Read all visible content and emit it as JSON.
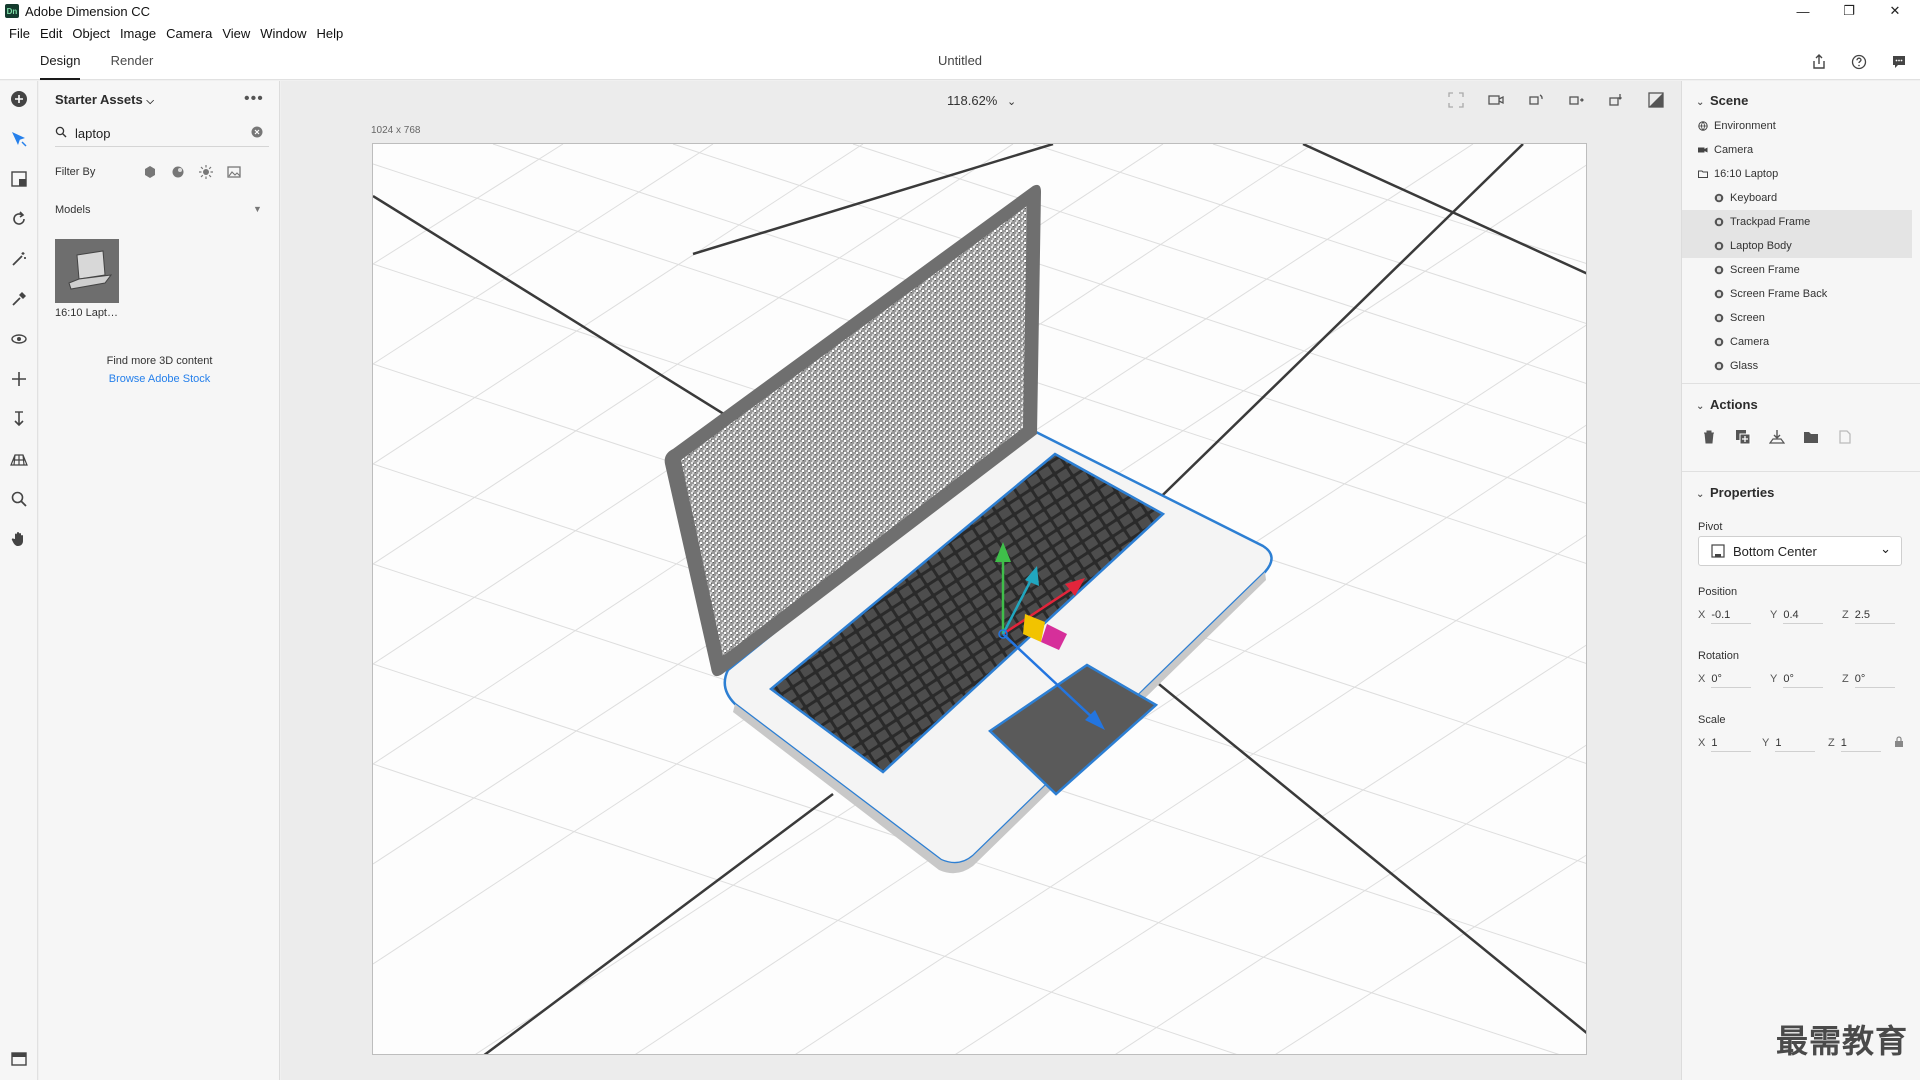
{
  "window": {
    "app_title": "Adobe Dimension CC",
    "logo_text": "Dn",
    "minimize_glyph": "—",
    "restore_glyph": "❐",
    "close_glyph": "✕"
  },
  "menu": [
    "File",
    "Edit",
    "Object",
    "Image",
    "Camera",
    "View",
    "Window",
    "Help"
  ],
  "modes": {
    "design": "Design",
    "render": "Render"
  },
  "document": {
    "title": "Untitled"
  },
  "assets": {
    "title": "Starter Assets",
    "more_glyph": "•••",
    "search_value": "laptop",
    "filter_label": "Filter By",
    "models_label": "Models",
    "models_caret": "▼",
    "thumbnail_label": "16:10 Laptop",
    "find_more": "Find more 3D content",
    "browse_link": "Browse Adobe Stock"
  },
  "canvas": {
    "zoom": "118.62%",
    "size_label": "1024 x 768"
  },
  "scene": {
    "heading": "Scene",
    "items": [
      {
        "label": "Environment",
        "icon": "globe-icon",
        "level": 0,
        "selected": false
      },
      {
        "label": "Camera",
        "icon": "camera-icon",
        "level": 0,
        "selected": false
      },
      {
        "label": "16:10 Laptop",
        "icon": "folder-icon",
        "level": 0,
        "selected": false
      },
      {
        "label": "Keyboard",
        "icon": "model-icon",
        "level": 1,
        "selected": false
      },
      {
        "label": "Trackpad Frame",
        "icon": "model-icon",
        "level": 1,
        "selected": true
      },
      {
        "label": "Laptop Body",
        "icon": "model-icon",
        "level": 1,
        "selected": true
      },
      {
        "label": "Screen Frame",
        "icon": "model-icon",
        "level": 1,
        "selected": false
      },
      {
        "label": "Screen Frame Back",
        "icon": "model-icon",
        "level": 1,
        "selected": false
      },
      {
        "label": "Screen",
        "icon": "model-icon",
        "level": 1,
        "selected": false
      },
      {
        "label": "Camera",
        "icon": "model-icon",
        "level": 1,
        "selected": false
      },
      {
        "label": "Glass",
        "icon": "model-icon",
        "level": 1,
        "selected": false
      }
    ]
  },
  "actions": {
    "heading": "Actions"
  },
  "properties": {
    "heading": "Properties",
    "pivot_label": "Pivot",
    "pivot_value": "Bottom Center",
    "position_label": "Position",
    "position": {
      "x": "-0.1",
      "y": "0.4",
      "z": "2.5"
    },
    "rotation_label": "Rotation",
    "rotation": {
      "x": "0°",
      "y": "0°",
      "z": "0°"
    },
    "scale_label": "Scale",
    "scale": {
      "x": "1",
      "y": "1",
      "z": "1"
    }
  },
  "axis_letters": {
    "x": "X",
    "y": "Y",
    "z": "Z"
  },
  "watermark": "最需教育",
  "colors": {
    "accent": "#2680eb",
    "selection_outline": "#2d7fd3",
    "gizmo_x": "#e2253b",
    "gizmo_y": "#3fbf4a",
    "gizmo_z": "#2375e0",
    "gizmo_yellow": "#f2c300",
    "gizmo_magenta": "#d62f9a",
    "gizmo_cyan": "#21a7c0"
  }
}
